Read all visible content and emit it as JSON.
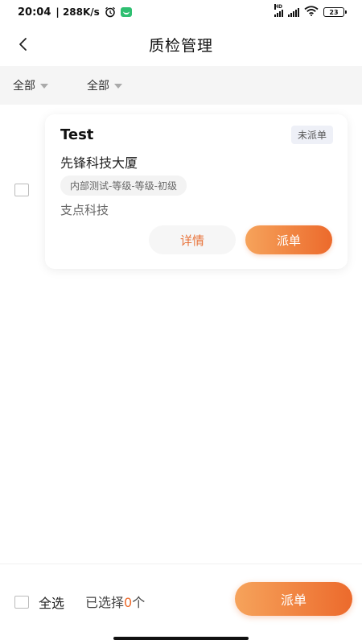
{
  "status_bar": {
    "time": "20:04",
    "net_speed": "| 288K/s",
    "battery": "23"
  },
  "header": {
    "title": "质检管理"
  },
  "filters": [
    {
      "label": "全部"
    },
    {
      "label": "全部"
    }
  ],
  "card": {
    "title": "Test",
    "status": "未派单",
    "address": "先锋科技大厦",
    "tag": "内部测试-等级-等级-初级",
    "company": "支点科技",
    "detail_label": "详情",
    "dispatch_label": "派单"
  },
  "bottom_bar": {
    "select_all_label": "全选",
    "selected_prefix": "已选择",
    "selected_count": "0",
    "selected_suffix": "个",
    "dispatch_label": "派单"
  },
  "colors": {
    "accent": "#ec6a2c",
    "accent_light": "#f6a35b",
    "filter_bg": "#f5f5f5",
    "status_badge_bg": "#eef0f7"
  }
}
